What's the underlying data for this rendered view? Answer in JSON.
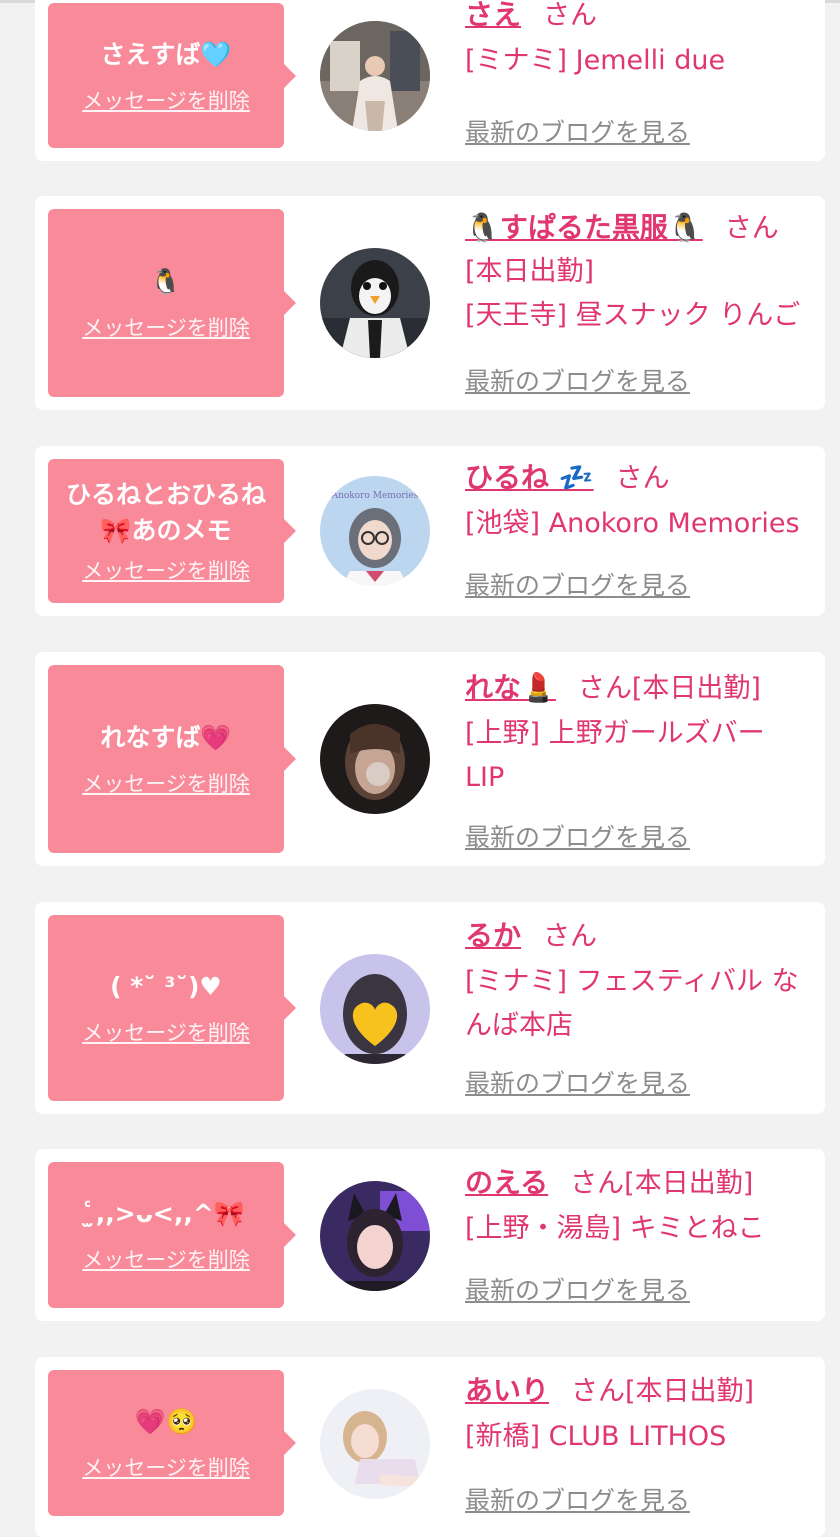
{
  "cards": [
    {
      "message": "さえすば🩵",
      "delete_label": "メッセージを削除",
      "name": "さえ",
      "san": "さん",
      "tag": "",
      "lines": [
        "[ミナミ] Jemelli due"
      ],
      "blog_label": "最新のブログを見る",
      "avatar_desc": "woman-in-kimono"
    },
    {
      "message": "🐧",
      "delete_label": "メッセージを削除",
      "name": "🐧すぱるた黒服🐧",
      "san": "さん",
      "tag": "",
      "lines": [
        "[本日出勤]",
        "[天王寺] 昼スナック りんご"
      ],
      "blog_label": "最新のブログを見る",
      "avatar_desc": "penguin-head-man"
    },
    {
      "message": "ひるねとおひるね\n🎀あのメモ",
      "delete_label": "メッセージを削除",
      "name": "ひるね 💤",
      "san": "さん",
      "tag": "",
      "lines": [
        "[池袋] Anokoro Memories"
      ],
      "blog_label": "最新のブログを見る",
      "avatar_desc": "girl-with-glasses"
    },
    {
      "message": "れなすば💗",
      "delete_label": "メッセージを削除",
      "name": "れな💄",
      "san": "さん",
      "tag": "[本日出勤]",
      "lines": [
        "[上野] 上野ガールズバー",
        "LIP"
      ],
      "blog_label": "最新のブログを見る",
      "avatar_desc": "blurred-girl"
    },
    {
      "message": "( *˘ ³˘)♥",
      "delete_label": "メッセージを削除",
      "name": "るか",
      "san": "さん",
      "tag": "",
      "lines": [
        "[ミナミ] フェスティバル な",
        "んば本店"
      ],
      "blog_label": "最新のブログを見る",
      "avatar_desc": "yellow-heart-face"
    },
    {
      "message": "̫ⷭ ,,>ᴗ<,,^🎀",
      "delete_label": "メッセージを削除",
      "name": "のえる",
      "san": "さん",
      "tag": "[本日出勤]",
      "lines": [
        "[上野・湯島] キミとねこ"
      ],
      "blog_label": "最新のブログを見る",
      "avatar_desc": "girl-with-cat-ears"
    },
    {
      "message": "💗🥺",
      "delete_label": "メッセージを削除",
      "name": "あいり",
      "san": "さん",
      "tag": "[本日出勤]",
      "lines": [
        "[新橋] CLUB LITHOS"
      ],
      "blog_label": "最新のブログを見る",
      "avatar_desc": "girl-lying-down"
    }
  ]
}
